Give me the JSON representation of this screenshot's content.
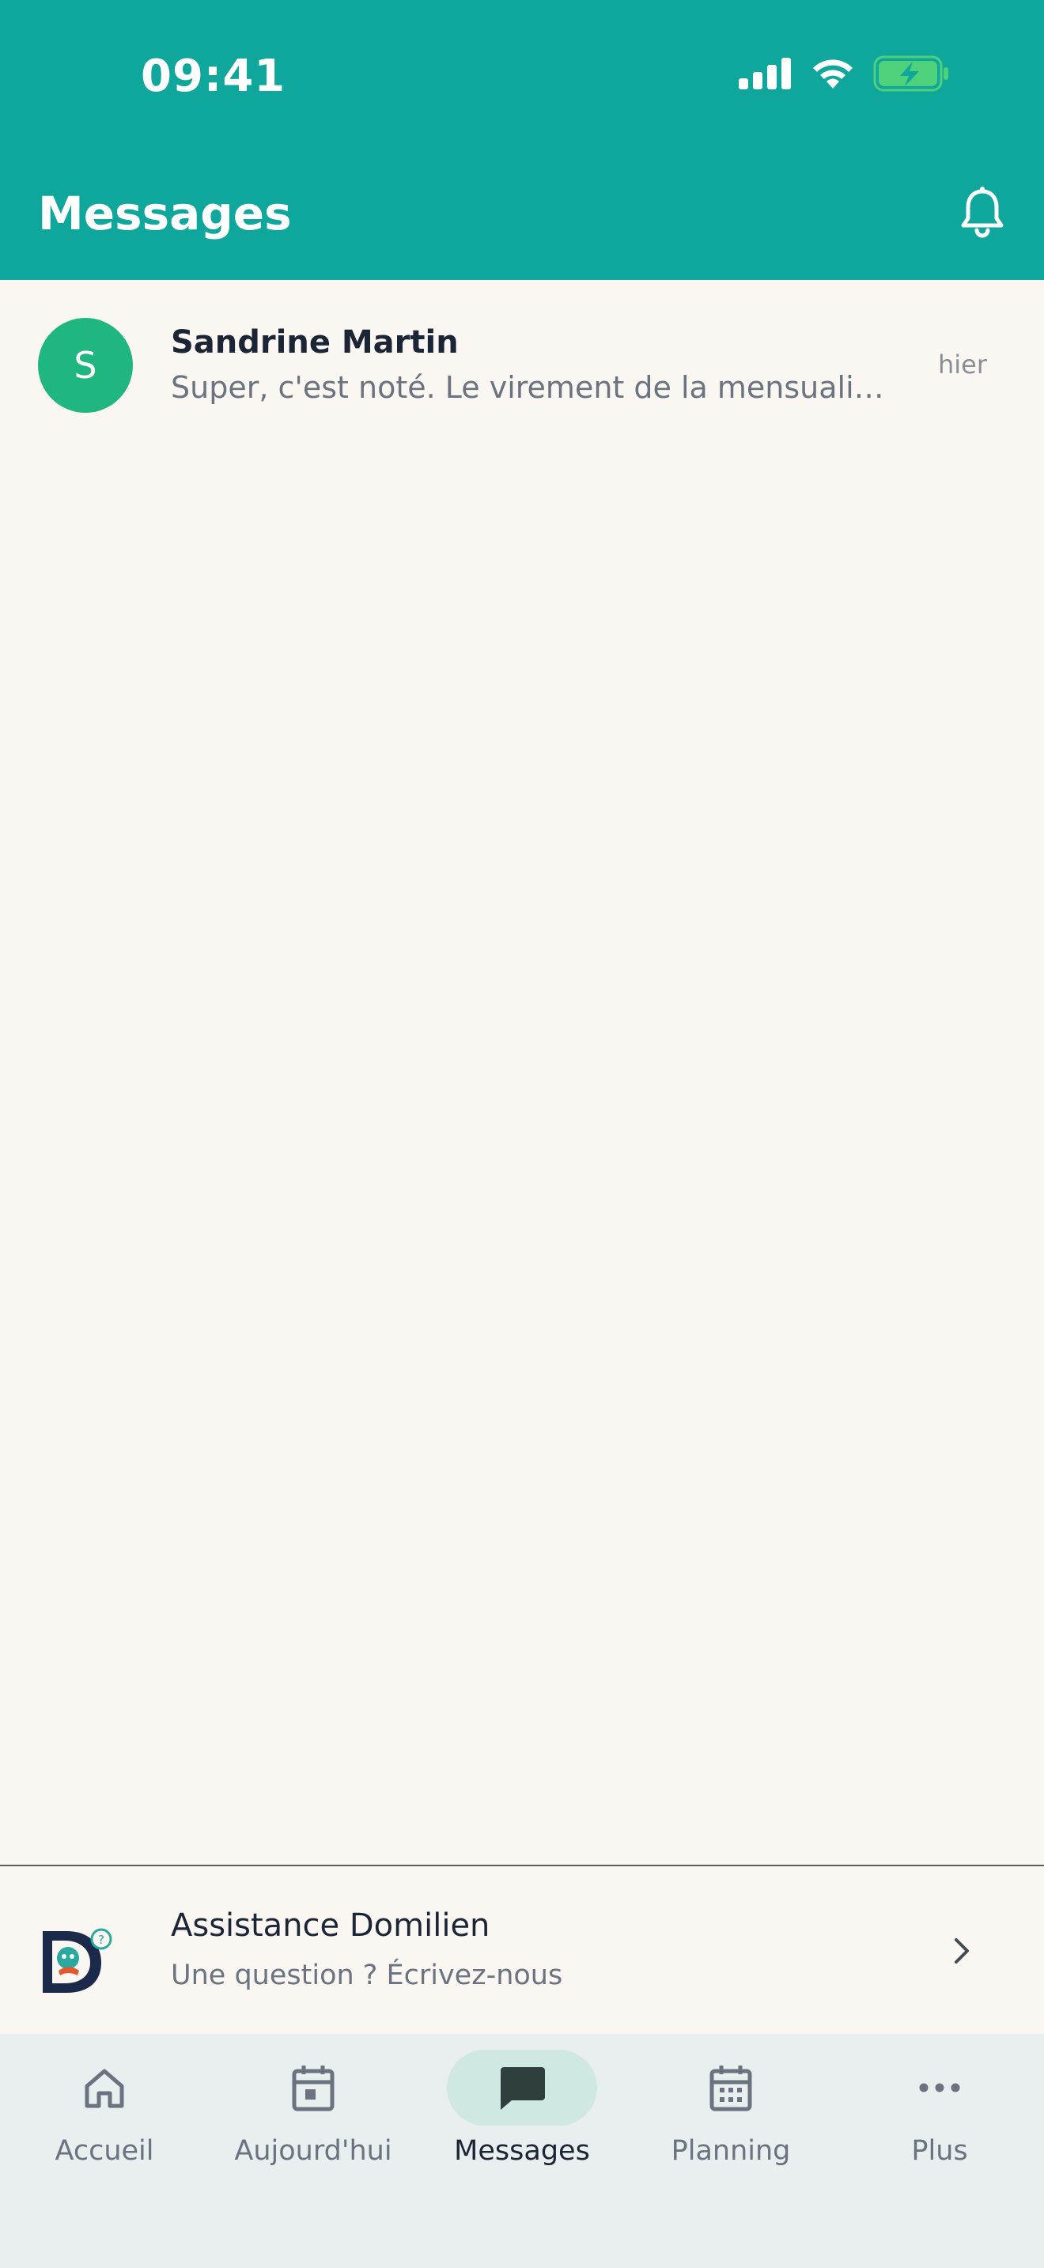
{
  "status_bar": {
    "time": "09:41"
  },
  "header": {
    "title": "Messages"
  },
  "conversations": [
    {
      "avatar_letter": "S",
      "name": "Sandrine Martin",
      "preview": "Super, c'est noté. Le virement de la mensualisation",
      "time": "hier",
      "avatar_color": "#1fb67f"
    }
  ],
  "support": {
    "title": "Assistance Domilien",
    "subtitle": "Une question ? Écrivez-nous"
  },
  "nav": {
    "items": [
      {
        "label": "Accueil",
        "icon": "home-icon"
      },
      {
        "label": "Aujourd'hui",
        "icon": "calendar-today-icon"
      },
      {
        "label": "Messages",
        "icon": "chat-icon",
        "active": true
      },
      {
        "label": "Planning",
        "icon": "calendar-grid-icon"
      },
      {
        "label": "Plus",
        "icon": "more-icon"
      }
    ]
  },
  "colors": {
    "brand": "#0fa69b",
    "avatar": "#1fb67f",
    "nav_active_pill": "#cfe8e2"
  }
}
